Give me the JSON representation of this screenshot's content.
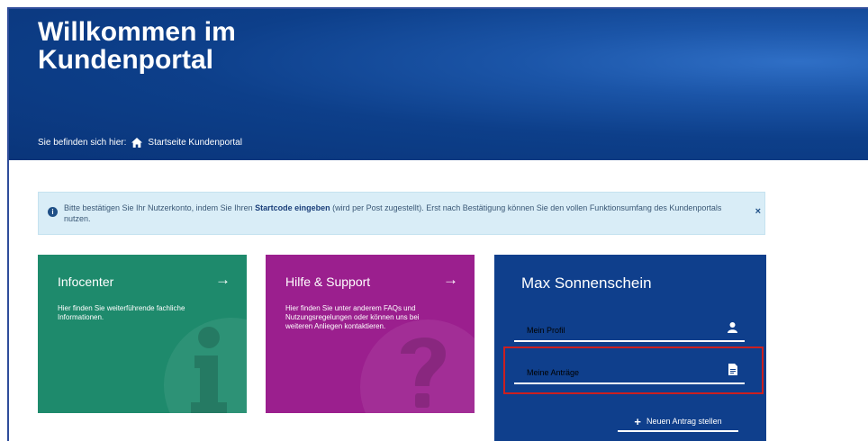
{
  "hero": {
    "title": "Willkommen im\nKundenportal",
    "breadcrumb_prefix": "Sie befinden sich hier:",
    "breadcrumb_current": "Startseite Kundenportal"
  },
  "alert": {
    "text_before": "Bitte bestätigen Sie Ihr Nutzerkonto, indem Sie Ihren ",
    "link_text": "Startcode eingeben",
    "text_after": " (wird per Post zugestellt). Erst nach Bestätigung können Sie den vollen Funktionsumfang des Kundenportals nutzen.",
    "close_label": "×"
  },
  "tiles": {
    "infocenter": {
      "title": "Infocenter",
      "arrow": "→",
      "description": "Hier finden Sie weiterführende fachliche Informationen.",
      "color": "#1e8a6c"
    },
    "help": {
      "title": "Hilfe & Support",
      "arrow": "→",
      "description": "Hier finden Sie unter anderem FAQs und Nutzungsregelungen oder können uns bei weiteren Anliegen kontaktieren.",
      "color": "#9b1f8e"
    }
  },
  "user_panel": {
    "name": "Max Sonnenschein",
    "profile_label": "Mein Profil",
    "requests_label": "Meine Anträge",
    "new_request_label": "Neuen Antrag stellen",
    "color": "#0f3f8c"
  },
  "icons": {
    "home": "home-icon",
    "info": "info-icon",
    "close": "close-icon",
    "arrow": "arrow-right-icon",
    "user": "user-icon",
    "document": "document-icon",
    "plus": "plus-icon"
  },
  "highlight_color": "#cc1f1f"
}
